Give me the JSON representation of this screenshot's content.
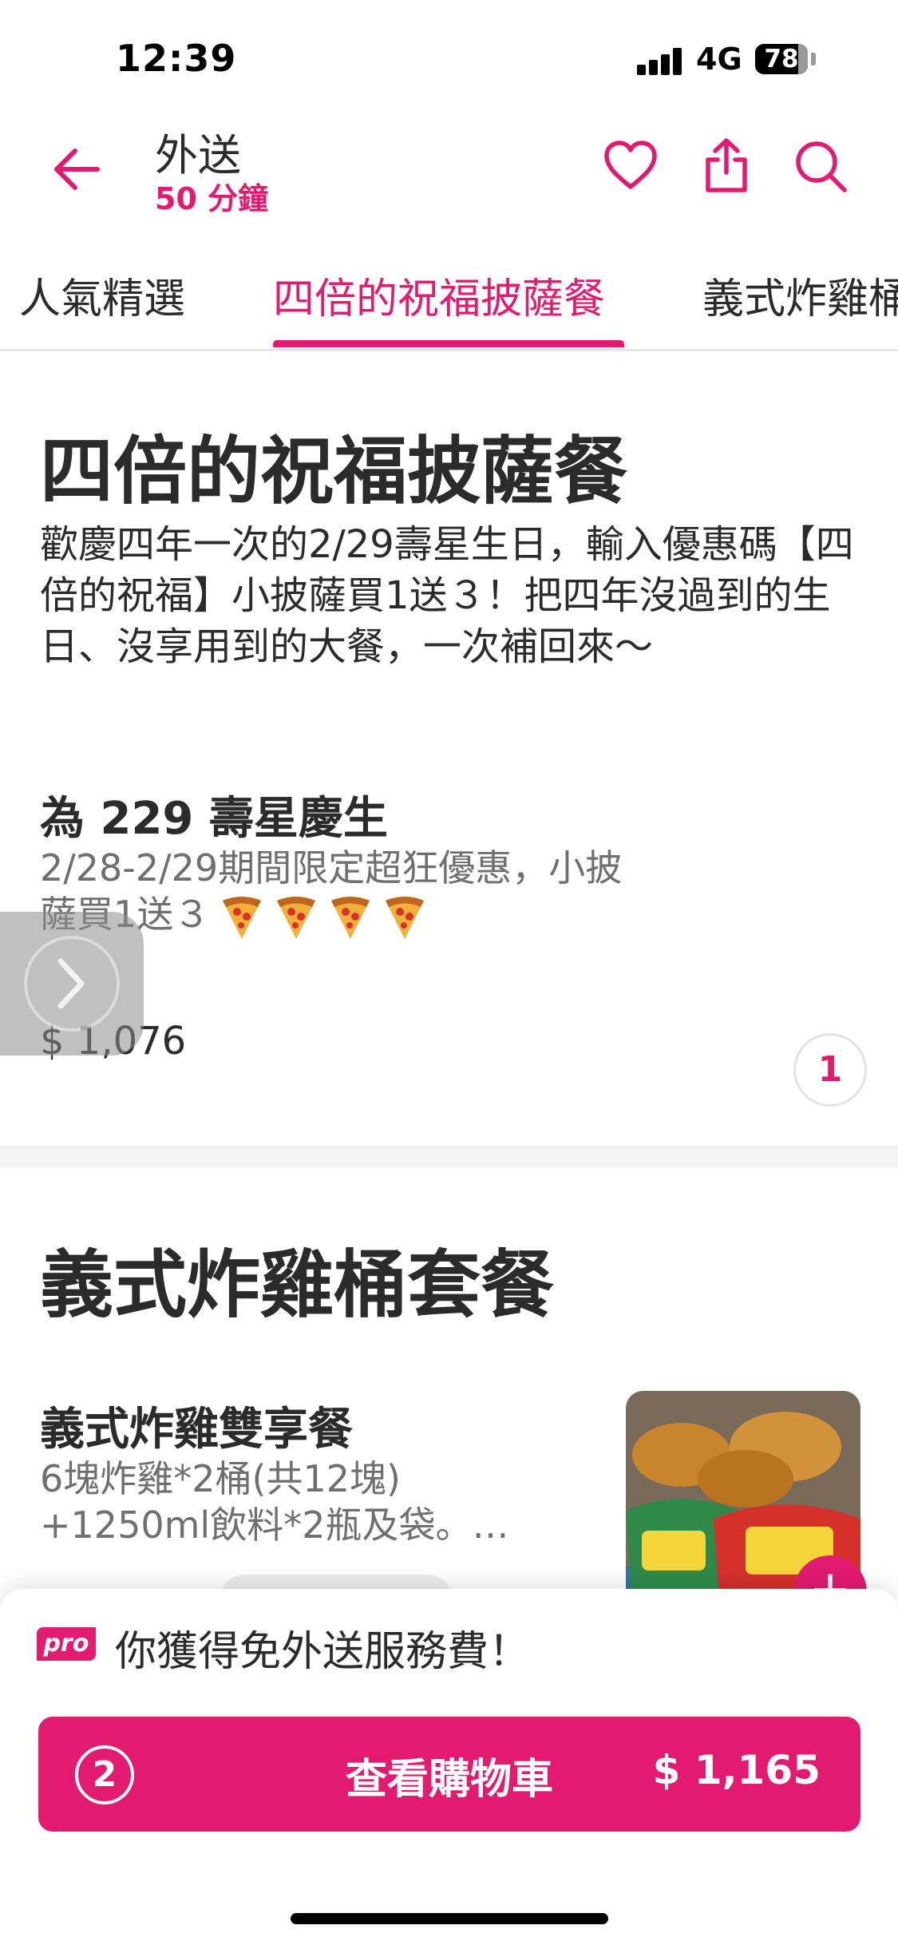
{
  "status_bar": {
    "time": "12:39",
    "network": "4G",
    "battery": "78"
  },
  "header": {
    "title": "外送",
    "subtitle": "50 分鐘"
  },
  "tabs": [
    {
      "label": "人氣精選"
    },
    {
      "label": "四倍的祝福披薩餐"
    },
    {
      "label": "義式炸雞桶"
    }
  ],
  "sections": [
    {
      "heading": "四倍的祝福披薩餐",
      "description": "歡慶四年一次的2/29壽星生日，輸入優惠碼【四倍的祝福】小披薩買1送３！把四年沒過到的生日、沒享用到的大餐，一次補回來～",
      "item": {
        "title_prefix": "為",
        "title_number": "229",
        "title_suffix": "壽星慶生",
        "desc_line1": "2/28-2/29期間限定超狂優惠，小披",
        "desc_line2": "薩買1送３",
        "price": "$ 1,076",
        "quantity": "1"
      }
    },
    {
      "heading": "義式炸雞桶套餐",
      "item": {
        "title": "義式炸雞雙享餐",
        "desc_line1": "6塊炸雞*2桶(共12塊)",
        "desc_line2": "+1250ml飲料*2瓶及袋。…"
      }
    }
  ],
  "bottom_bar": {
    "pro_badge": "pro",
    "pro_text": "你獲得免外送服務費！",
    "cart_count": "2",
    "cart_label": "查看購物車",
    "cart_total": "$ 1,165"
  },
  "colors": {
    "brand": "#e21b70"
  }
}
